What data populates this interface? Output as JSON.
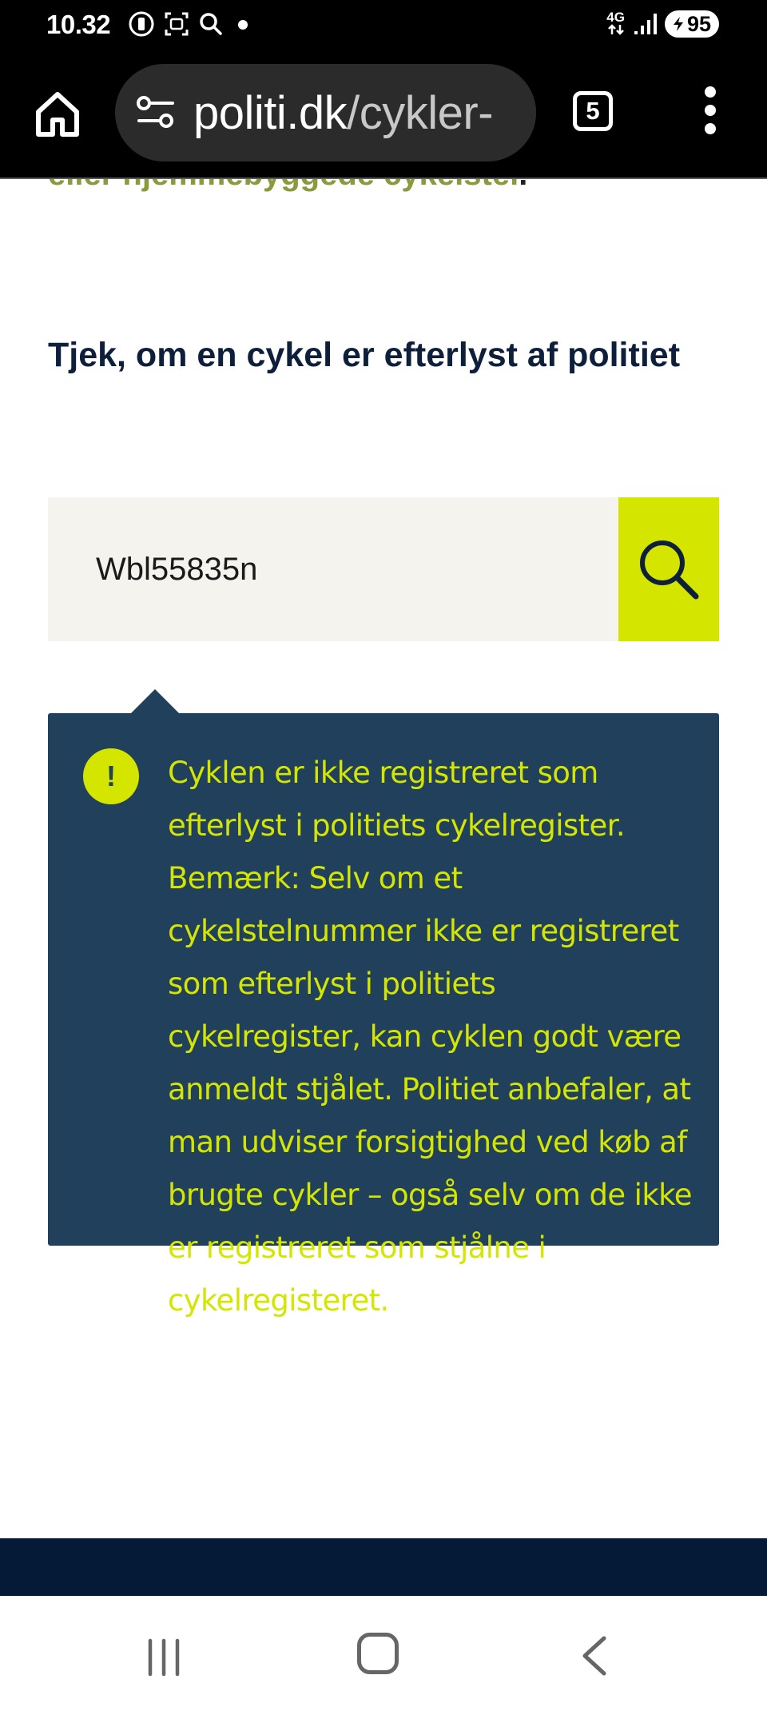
{
  "status_bar": {
    "time": "10.32",
    "network_type": "4G",
    "battery_level": "95"
  },
  "browser": {
    "url_domain": "politi.dk",
    "url_path": "/cykler-",
    "tab_count": "5"
  },
  "page": {
    "cut_off_text": "eller hjemmebyggede cykelstel",
    "cut_off_period": ".",
    "heading": "Tjek, om en cykel er efterlyst af politiet",
    "search": {
      "value": "Wbl55835n",
      "placeholder": ""
    },
    "result": {
      "message": "Cyklen er ikke registreret som efterlyst i politiets cykelregister. Bemærk: Selv om et cykelstelnummer ikke er registreret som efterlyst i politiets cykelregister, kan cyklen godt være anmeldt stjålet. Politiet anbefaler, at man udviser forsigtighed ved køb af brugte cykler – også selv om de ikke er registreret som stjålne i cykelregisteret."
    }
  },
  "colors": {
    "accent_yellow": "#d4e600",
    "result_background": "#20405c",
    "heading_navy": "#0d1f3b",
    "footer_navy": "#051a36",
    "search_field_background": "#f5f3ee"
  },
  "icons": {
    "status_left": [
      "alarm-icon",
      "screenshot-icon",
      "search-icon",
      "notification-dot-icon"
    ],
    "status_right": [
      "data-arrows-icon",
      "signal-icon",
      "battery-icon"
    ],
    "toolbar": [
      "home-icon",
      "site-settings-icon",
      "tabs-icon",
      "more-vert-icon"
    ],
    "content": [
      "magnifier-icon",
      "exclamation-icon"
    ],
    "nav": [
      "recents-icon",
      "home-nav-icon",
      "back-icon"
    ]
  }
}
